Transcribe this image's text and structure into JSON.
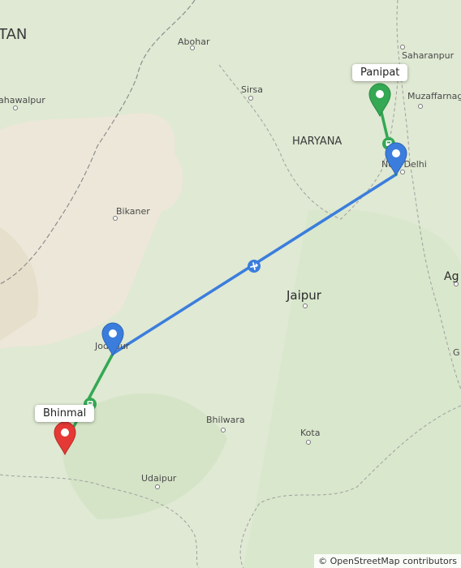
{
  "map": {
    "region_labels": {
      "country_partial": "TAN",
      "haryana": "HARYANA"
    },
    "cities": {
      "abohar": "Abohar",
      "sirsa": "Sirsa",
      "saharanpur": "Saharanpur",
      "muzaffarnagar": "Muzaffarnaga",
      "bahawalpur": "ahawalpur",
      "new_delhi": "New Delhi",
      "bikaner": "Bikaner",
      "jaipur": "Jaipur",
      "agra_partial": "Ag",
      "gwalior_partial": "G",
      "jodhpur": "Jodhpur",
      "bhilwara": "Bhilwara",
      "kota": "Kota",
      "udaipur": "Udaipur"
    },
    "markers": {
      "origin": {
        "label": "Bhinmal",
        "color": "#e53935"
      },
      "destination": {
        "label": "Panipat",
        "color": "#34a853"
      }
    },
    "route_colors": {
      "ground": "#34a853",
      "flight": "#3b7ddd"
    },
    "icons": {
      "flight": "airplane-icon",
      "transit": "train-icon",
      "origin": "red-pin-icon",
      "destination": "green-pin-icon",
      "waypoint": "blue-pin-icon"
    },
    "attribution": "© OpenStreetMap contributors"
  }
}
